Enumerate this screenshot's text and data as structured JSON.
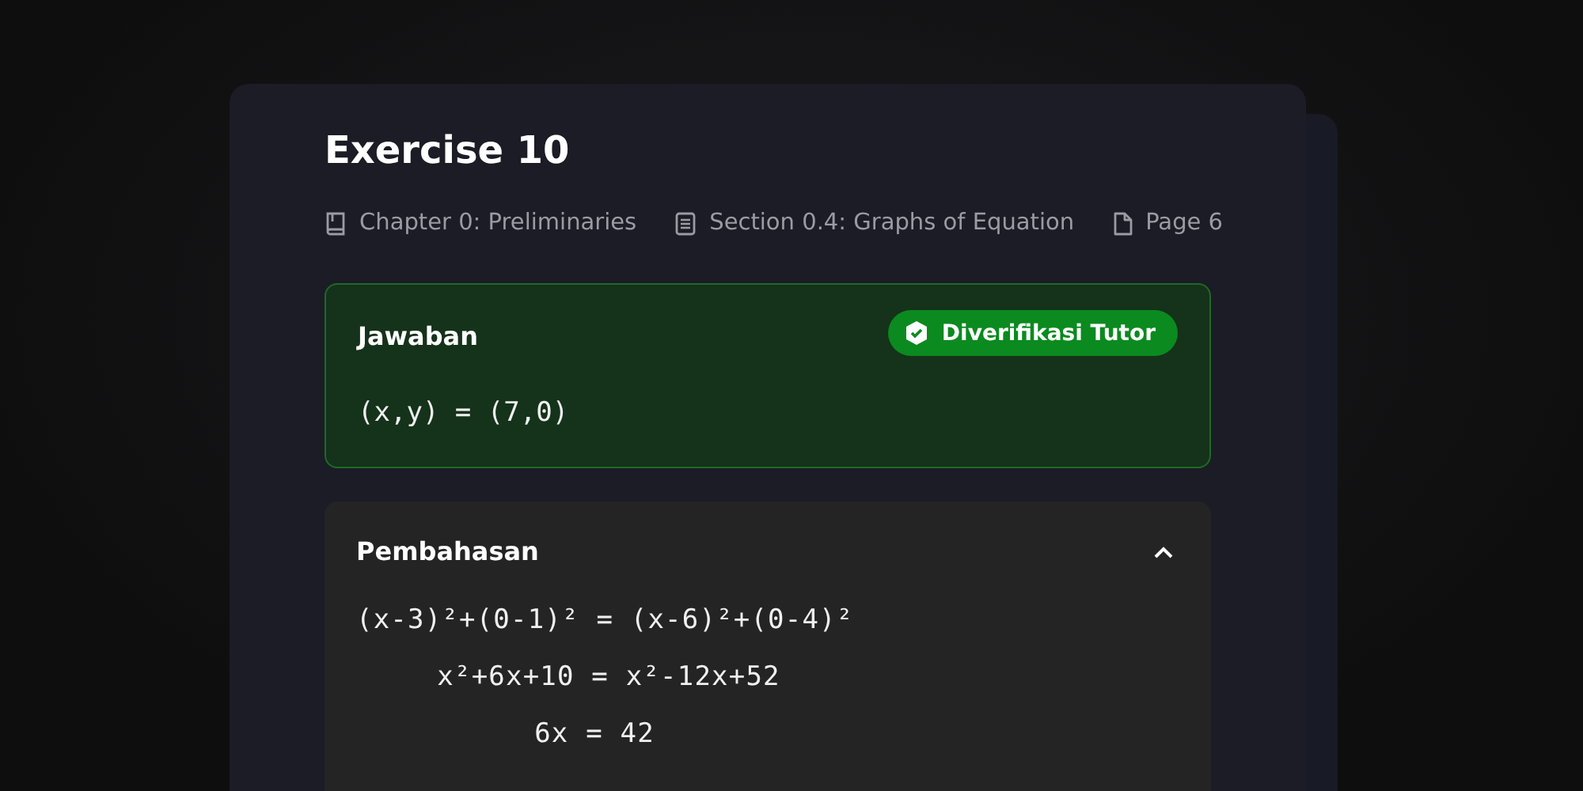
{
  "title": "Exercise 10",
  "meta": [
    {
      "kind": "book",
      "text": "Chapter 0: Preliminaries"
    },
    {
      "kind": "list",
      "text": "Section 0.4: Graphs of Equation"
    },
    {
      "kind": "page",
      "text": "Page 6"
    }
  ],
  "answer": {
    "heading": "Jawaban",
    "badge": "Diverifikasi Tutor",
    "verified": true,
    "text": "(x,y) = (7,0)"
  },
  "solution": {
    "heading": "Pembahasan",
    "expanded": true,
    "lines": [
      "(x-3)²+(0-1)² = (x-6)²+(0-4)²",
      "x²+6x+10 = x²-12x+52",
      "6x = 42"
    ]
  }
}
